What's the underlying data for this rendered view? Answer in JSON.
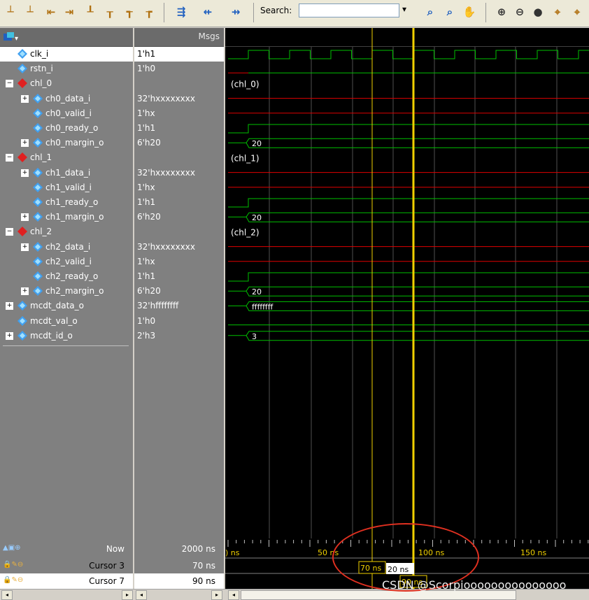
{
  "toolbar": {
    "search_label": "Search:",
    "search_value": ""
  },
  "msgs_header": "Msgs",
  "signals": [
    {
      "name": "clk_i",
      "value": "1'h1",
      "icon": "signal-blue-icon"
    },
    {
      "name": "rstn_i",
      "value": "1'h0",
      "icon": "signal-blue-icon"
    },
    {
      "name": "chl_0",
      "value": "",
      "icon": "group-red-icon"
    },
    {
      "name": "ch0_data_i",
      "value": "32'hxxxxxxxx",
      "icon": "signal-blue-icon"
    },
    {
      "name": "ch0_valid_i",
      "value": "1'hx",
      "icon": "signal-blue-icon"
    },
    {
      "name": "ch0_ready_o",
      "value": "1'h1",
      "icon": "signal-blue-icon"
    },
    {
      "name": "ch0_margin_o",
      "value": "6'h20",
      "icon": "signal-blue-icon"
    },
    {
      "name": "chl_1",
      "value": "",
      "icon": "group-red-icon"
    },
    {
      "name": "ch1_data_i",
      "value": "32'hxxxxxxxx",
      "icon": "signal-blue-icon"
    },
    {
      "name": "ch1_valid_i",
      "value": "1'hx",
      "icon": "signal-blue-icon"
    },
    {
      "name": "ch1_ready_o",
      "value": "1'h1",
      "icon": "signal-blue-icon"
    },
    {
      "name": "ch1_margin_o",
      "value": "6'h20",
      "icon": "signal-blue-icon"
    },
    {
      "name": "chl_2",
      "value": "",
      "icon": "group-red-icon"
    },
    {
      "name": "ch2_data_i",
      "value": "32'hxxxxxxxx",
      "icon": "signal-blue-icon"
    },
    {
      "name": "ch2_valid_i",
      "value": "1'hx",
      "icon": "signal-blue-icon"
    },
    {
      "name": "ch2_ready_o",
      "value": "1'h1",
      "icon": "signal-blue-icon"
    },
    {
      "name": "ch2_margin_o",
      "value": "6'h20",
      "icon": "signal-blue-icon"
    },
    {
      "name": "mcdt_data_o",
      "value": "32'hffffffff",
      "icon": "signal-blue-icon"
    },
    {
      "name": "mcdt_val_o",
      "value": "1'h0",
      "icon": "signal-blue-icon"
    },
    {
      "name": "mcdt_id_o",
      "value": "2'h3",
      "icon": "signal-blue-icon"
    }
  ],
  "wave_labels": {
    "chl0": "(chl_0)",
    "chl1": "(chl_1)",
    "chl2": "(chl_2)",
    "margin0": "20",
    "margin1": "20",
    "margin2": "20",
    "mcdt_data": "ffffffff",
    "mcdt_id": "3"
  },
  "bottom": {
    "now_label": "Now",
    "now_value": "2000 ns",
    "cursor3_label": "Cursor 3",
    "cursor3_value": "70 ns",
    "cursor7_label": "Cursor 7",
    "cursor7_value": "90 ns"
  },
  "timeline": {
    "tick_0": ") ns",
    "tick_50": "50 ns",
    "tick_100": "100 ns",
    "tick_150": "150 ns",
    "cursor3_tag": "70 ns",
    "delta_tag": "20 ns",
    "cursor7_tag": "90 ns"
  },
  "colors": {
    "clock_green": "#00c000",
    "undefined_red": "#e00000",
    "cursor_yellow": "#f0d000",
    "annotation_red": "#e03020"
  },
  "watermark": "CSDN @Scorpiooooooooooooooo"
}
